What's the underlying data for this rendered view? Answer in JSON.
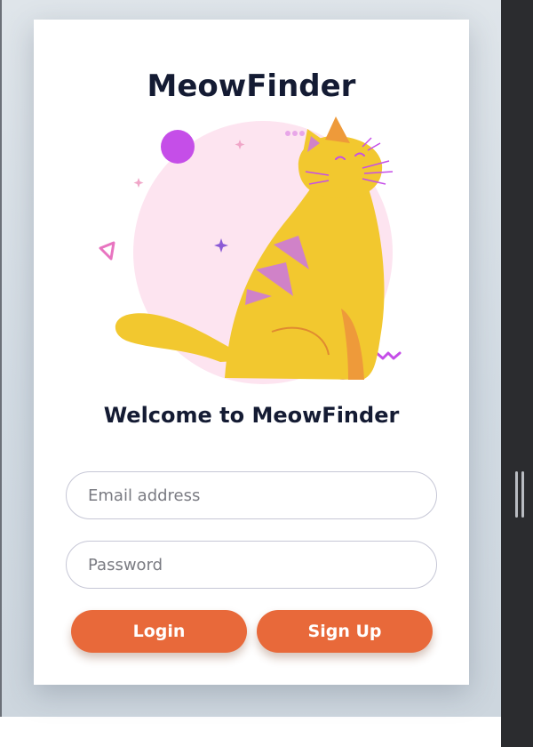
{
  "app": {
    "title": "MeowFinder",
    "welcome": "Welcome to MeowFinder"
  },
  "form": {
    "email_placeholder": "Email address",
    "password_placeholder": "Password",
    "login_label": "Login",
    "signup_label": "Sign Up"
  },
  "colors": {
    "primary": "#e8693a",
    "heading": "#141b33",
    "cat": "#f2c82f",
    "accent": "#c54ee8",
    "blob": "#fde4f0"
  },
  "illustration": {
    "icon": "cat-illustration"
  }
}
